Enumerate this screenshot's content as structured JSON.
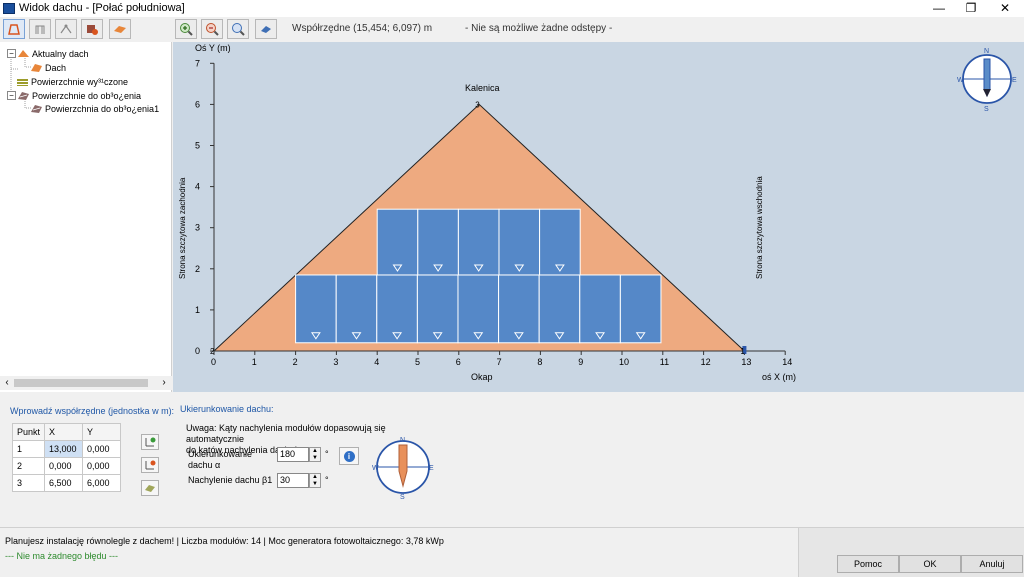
{
  "window": {
    "title": "Widok dachu - [Połać południowa]",
    "minimize": "—",
    "maximize": "❐",
    "close": "✕"
  },
  "toolbar": {
    "coords_label": "Współrzędne (15,454; 6,097) m",
    "no_gaps_label": "- Nie są możliwe żadne odstępy -"
  },
  "tree": {
    "items": [
      {
        "label": "Aktualny dach",
        "color": "#e8863a"
      },
      {
        "label": "Dach",
        "color": "#e8863a"
      },
      {
        "label": "Powierzchnie wy³¹czone",
        "color": "#9c9c2a"
      },
      {
        "label": "Powierzchnie do ob³o¿enia",
        "color": "#7a5a5a"
      },
      {
        "label": "Powierzchnia do ob³o¿enia1",
        "color": "#7a5a5a"
      }
    ]
  },
  "chart_data": {
    "type": "diagram",
    "x_axis_label": "oś X (m)",
    "y_axis_label": "Oś Y (m)",
    "x_ticks": [
      "0",
      "1",
      "2",
      "3",
      "4",
      "5",
      "6",
      "7",
      "8",
      "9",
      "10",
      "11",
      "12",
      "13",
      "14"
    ],
    "y_ticks": [
      "0",
      "1",
      "2",
      "3",
      "4",
      "5",
      "6",
      "7"
    ],
    "xlim": [
      0,
      14
    ],
    "ylim": [
      0,
      7
    ],
    "ridge_label": "Kalenica",
    "eaves_label": "Okap",
    "west_label": "Strona szczytowa zachodnia",
    "east_label": "Strona szczytowa wschodnia",
    "roof_polygon": [
      [
        0,
        0
      ],
      [
        6.5,
        6
      ],
      [
        13,
        0
      ]
    ],
    "vertex_labels": [
      {
        "label": "2",
        "x": 0,
        "y": 0
      },
      {
        "label": "3",
        "x": 6.5,
        "y": 6
      },
      {
        "label": "1",
        "x": 13,
        "y": 0
      }
    ],
    "module_rows": [
      {
        "x_start": 2,
        "y_bottom": 0.2,
        "y_top": 1.85,
        "count": 9,
        "module_width": 0.995
      },
      {
        "x_start": 4,
        "y_bottom": 1.85,
        "y_top": 3.45,
        "count": 5,
        "module_width": 0.995
      }
    ],
    "roof_color": "#eeaa80",
    "module_color": "#5588c8"
  },
  "compass_labels": {
    "n": "N",
    "s": "S",
    "w": "W",
    "e": "E"
  },
  "bottom": {
    "coords_title": "Wprowadź współrzędne (jednostka w m):",
    "table_headers": [
      "Punkt",
      "X",
      "Y"
    ],
    "table_rows": [
      [
        "1",
        "13,000",
        "0,000"
      ],
      [
        "2",
        "0,000",
        "0,000"
      ],
      [
        "3",
        "6,500",
        "6,000"
      ]
    ],
    "orientation_title": "Ukierunkowanie dachu:",
    "note_line1": "Uwaga: Kąty nachylenia modułów dopasowują się automatycznie",
    "note_line2": "do kątów nachylenia dachu!",
    "azimuth_label_1": "Ukierunkowanie",
    "azimuth_label_2": "dachu α",
    "azimuth_value": "180",
    "tilt_label": "Nachylenie dachu β1",
    "tilt_value": "30",
    "degree": "°"
  },
  "status": {
    "line1": "Planujesz instalację równolegle z dachem! | Liczba modułów: 14 | Moc generatora fotowoltaicznego: 3,78 kWp",
    "line2": "--- Nie ma żadnego błędu ---",
    "help": "Pomoc",
    "ok": "OK",
    "cancel": "Anuluj"
  }
}
